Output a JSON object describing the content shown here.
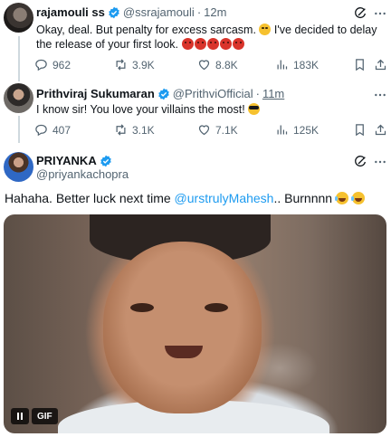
{
  "tweets": [
    {
      "name": "rajamouli ss",
      "handle": "@ssrajamouli",
      "time": "12m",
      "text_a": "Okay, deal. But penalty for excess sarcasm.",
      "text_b": "I've decided  to delay the release of your first look.",
      "stats": {
        "replies": "962",
        "retweets": "3.9K",
        "likes": "8.8K",
        "views": "183K"
      }
    },
    {
      "name": "Prithviraj Sukumaran",
      "handle": "@PrithviOfficial",
      "time": "11m",
      "text": "I know sir! You love your villains the most!",
      "stats": {
        "replies": "407",
        "retweets": "3.1K",
        "likes": "7.1K",
        "views": "125K"
      }
    },
    {
      "name": "PRIYANKA",
      "handle": "@priyankachopra",
      "text_a": "Hahaha. Better luck next time ",
      "mention": "@urstrulyMahesh",
      "text_b": ".. Burnnnn ",
      "gif_label": "GIF"
    }
  ],
  "colors": {
    "verified": "#1d9bf0",
    "secondary_text": "#536471",
    "mention": "#1d9bf0",
    "angry_emoji": "#d9342b"
  },
  "icons": [
    "grok-icon",
    "more-icon",
    "reply-icon",
    "retweet-icon",
    "like-icon",
    "views-icon",
    "bookmark-icon",
    "share-icon",
    "pause-icon"
  ]
}
